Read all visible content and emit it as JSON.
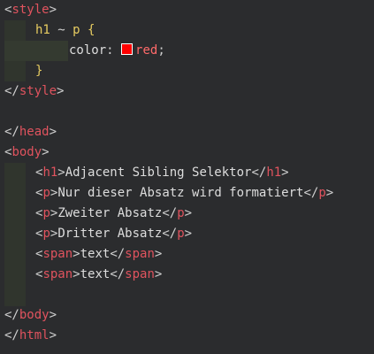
{
  "code": {
    "style_open": "style",
    "selector_h1": "h1",
    "combinator": "~",
    "selector_p": "p",
    "brace_open": "{",
    "property": "color",
    "colon": ":",
    "value": "red",
    "semicolon": ";",
    "swatch_color": "#ff0000",
    "brace_close": "}",
    "style_close": "style",
    "head_close": "head",
    "body_open": "body",
    "body_lines": [
      {
        "tag": "h1",
        "text": "Adjacent Sibling Selektor"
      },
      {
        "tag": "p",
        "text": "Nur dieser Absatz wird formatiert"
      },
      {
        "tag": "p",
        "text": "Zweiter Absatz"
      },
      {
        "tag": "p",
        "text": "Dritter Absatz"
      },
      {
        "tag": "span",
        "text": "text"
      },
      {
        "tag": "span",
        "text": "text"
      }
    ],
    "body_close": "body",
    "html_close": "html"
  }
}
